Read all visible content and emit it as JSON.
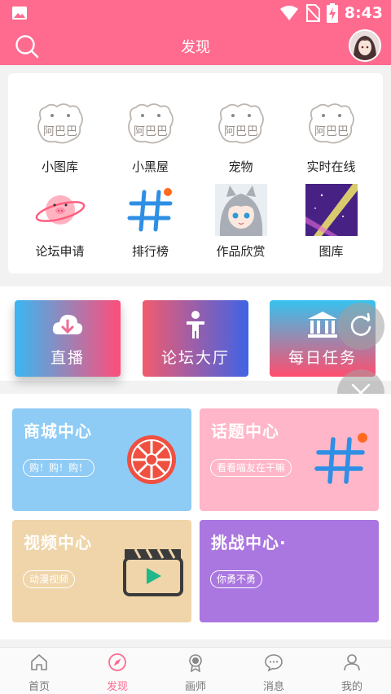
{
  "status_bar": {
    "time": "8:43"
  },
  "app_bar": {
    "title": "发现"
  },
  "top_grid": [
    {
      "label": "小图库",
      "icon": "pig-sticker-icon"
    },
    {
      "label": "小黑屋",
      "icon": "pig-sticker-icon"
    },
    {
      "label": "宠物",
      "icon": "pig-sticker-icon"
    },
    {
      "label": "实时在线",
      "icon": "pig-sticker-icon"
    },
    {
      "label": "论坛申请",
      "icon": "pig-planet-icon"
    },
    {
      "label": "排行榜",
      "icon": "hashtag-icon"
    },
    {
      "label": "作品欣赏",
      "icon": "anime-catgirl-thumbnail"
    },
    {
      "label": "图库",
      "icon": "purple-galaxy-thumbnail"
    }
  ],
  "gradient_buttons": [
    {
      "label": "直播",
      "icon": "cloud-download-icon"
    },
    {
      "label": "论坛大厅",
      "icon": "person-icon"
    },
    {
      "label": "每日任务",
      "icon": "bank-icon"
    }
  ],
  "feature_cards": [
    {
      "title": "商城中心",
      "tag": "购！购！购！",
      "icon": "wheel-icon",
      "color": "#8ecbf5"
    },
    {
      "title": "话题中心",
      "tag": "看看喵友在干嘛",
      "icon": "hashtag-icon",
      "color": "#ffb6c8"
    },
    {
      "title": "视频中心",
      "tag": "动漫视频",
      "icon": "clapperboard-icon",
      "color": "#efd5a9"
    },
    {
      "title": "挑战中心·",
      "tag": "你勇不勇",
      "icon": "",
      "color": "#aa76e0"
    }
  ],
  "tabs": [
    {
      "label": "首页",
      "icon": "home-icon"
    },
    {
      "label": "发现",
      "icon": "compass-icon"
    },
    {
      "label": "画师",
      "icon": "medal-icon"
    },
    {
      "label": "消息",
      "icon": "chat-bubble-icon"
    },
    {
      "label": "我的",
      "icon": "profile-icon"
    }
  ],
  "colors": {
    "brand": "#ff6b8f",
    "active_tab": "#ff6b8f"
  }
}
